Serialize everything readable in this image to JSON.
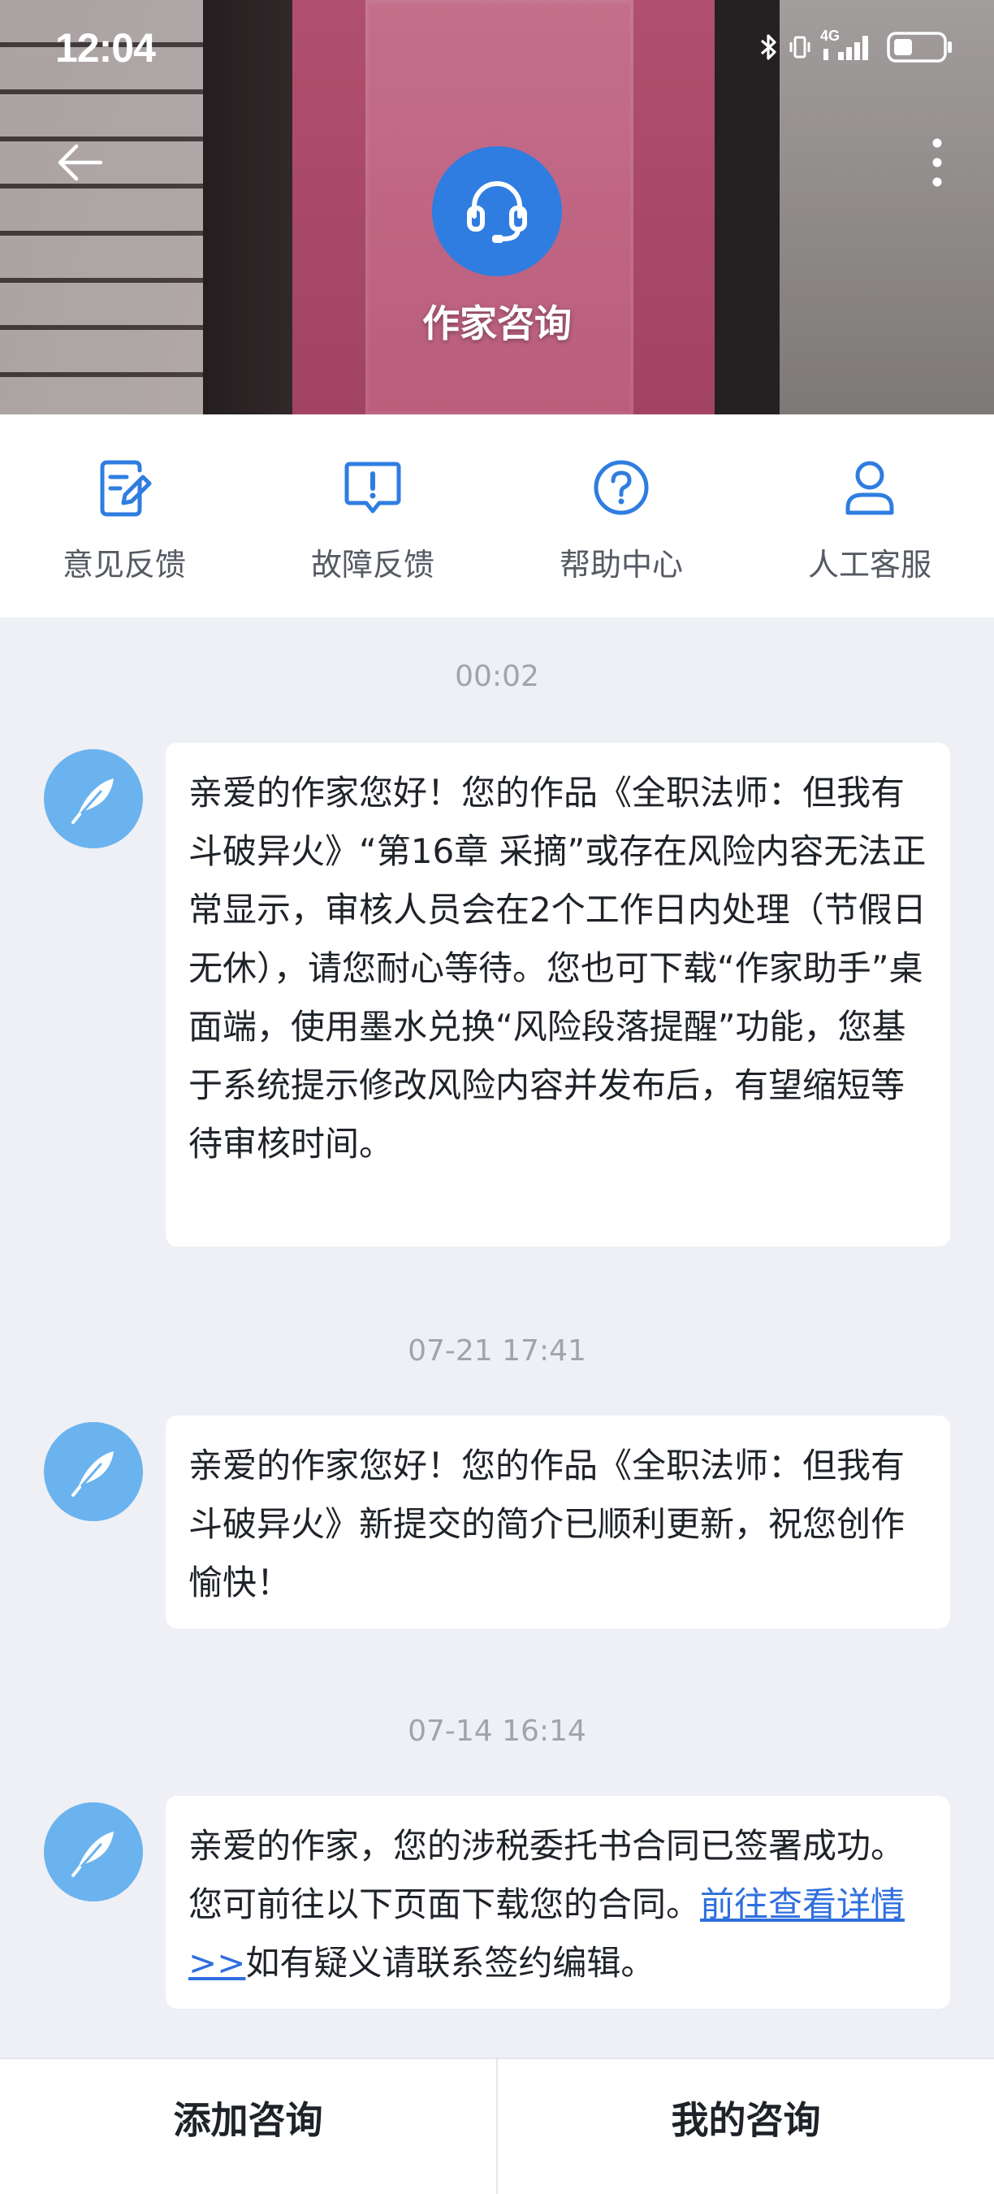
{
  "status_bar": {
    "time": "12:04",
    "network": "4G"
  },
  "header": {
    "title": "作家咨询"
  },
  "quick_actions": [
    {
      "label": "意见反馈",
      "icon": "feedback-edit-icon"
    },
    {
      "label": "故障反馈",
      "icon": "fault-report-icon"
    },
    {
      "label": "帮助中心",
      "icon": "help-question-icon"
    },
    {
      "label": "人工客服",
      "icon": "person-icon"
    }
  ],
  "messages": [
    {
      "time": "00:02",
      "text": "亲爱的作家您好！您的作品《全职法师：但我有斗破异火》“第16章 采摘”或存在风险内容无法正常显示，审核人员会在2个工作日内处理（节假日无休），请您耐心等待。您也可下载“作家助手”桌面端，使用墨水兑换“风险段落提醒”功能，您基于系统提示修改风险内容并发布后，有望缩短等待审核时间。"
    },
    {
      "time": "07-21 17:41",
      "text": "亲爱的作家您好！您的作品《全职法师：但我有斗破异火》新提交的简介已顺利更新，祝您创作愉快！"
    },
    {
      "time": "07-14 16:14",
      "text_before": "亲爱的作家，您的涉税委托书合同已签署成功。您可前往以下页面下载您的合同。",
      "link": "前往查看详情>>",
      "text_after": "如有疑义请联系签约编辑。"
    }
  ],
  "bottom_bar": {
    "add_label": "添加咨询",
    "mine_label": "我的咨询"
  },
  "colors": {
    "accent": "#2f7de1",
    "link": "#2f6fde",
    "avatar": "#6ab3ef",
    "background": "#eef0f5"
  }
}
